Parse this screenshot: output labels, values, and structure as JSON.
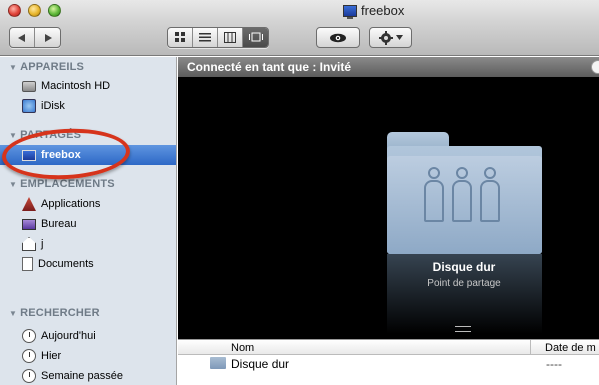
{
  "window": {
    "title": "freebox"
  },
  "toolbar": {
    "back_icon": "back-arrow-icon",
    "forward_icon": "forward-arrow-icon",
    "view_modes": [
      "icon-view",
      "list-view",
      "column-view",
      "coverflow-view"
    ],
    "active_view": "coverflow-view",
    "quicklook_icon": "eye-icon",
    "action_icon": "gear-icon"
  },
  "sidebar": {
    "sections": [
      {
        "title": "APPAREILS",
        "items": [
          {
            "label": "Macintosh HD",
            "icon": "hard-drive-icon"
          },
          {
            "label": "iDisk",
            "icon": "idisk-icon"
          }
        ]
      },
      {
        "title": "PARTAGÉS",
        "items": [
          {
            "label": "freebox",
            "icon": "network-computer-icon",
            "selected": true
          }
        ]
      },
      {
        "title": "EMPLACEMENTS",
        "items": [
          {
            "label": "Applications",
            "icon": "applications-icon"
          },
          {
            "label": "Bureau",
            "icon": "desktop-icon"
          },
          {
            "label": "j",
            "icon": "home-icon"
          },
          {
            "label": "Documents",
            "icon": "documents-icon"
          }
        ]
      },
      {
        "title": "RECHERCHER",
        "items": [
          {
            "label": "Aujourd'hui",
            "icon": "clock-icon"
          },
          {
            "label": "Hier",
            "icon": "clock-icon"
          },
          {
            "label": "Semaine passée",
            "icon": "clock-icon"
          }
        ]
      }
    ]
  },
  "main": {
    "header": "Connecté en tant que : Invité",
    "coverflow": {
      "item_name": "Disque dur",
      "item_kind": "Point de partage"
    },
    "columns": {
      "name": "Nom",
      "date": "Date de m"
    },
    "rows": [
      {
        "name": "Disque dur",
        "date": "----"
      }
    ]
  },
  "colors": {
    "selection": "#2d68c6",
    "sidebar_bg": "#dde4ec",
    "annotation": "#d6341c"
  }
}
